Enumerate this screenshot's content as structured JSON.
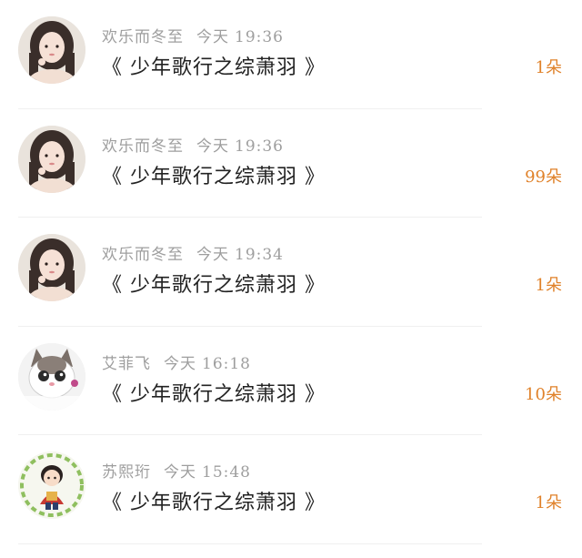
{
  "colors": {
    "count": "#e0822a",
    "meta": "#9e9e9e",
    "title": "#222222"
  },
  "items": [
    {
      "name": "欢乐而冬至",
      "time_prefix": "今天",
      "time": "19:36",
      "title": "《 少年歌行之综萧羽 》",
      "count": "1朵",
      "avatar": "girl-avatar"
    },
    {
      "name": "欢乐而冬至",
      "time_prefix": "今天",
      "time": "19:36",
      "title": "《 少年歌行之综萧羽 》",
      "count": "99朵",
      "avatar": "girl-avatar"
    },
    {
      "name": "欢乐而冬至",
      "time_prefix": "今天",
      "time": "19:34",
      "title": "《 少年歌行之综萧羽 》",
      "count": "1朵",
      "avatar": "girl-avatar"
    },
    {
      "name": "艾菲飞",
      "time_prefix": "今天",
      "time": "16:18",
      "title": "《 少年歌行之综萧羽 》",
      "count": "10朵",
      "avatar": "cat-avatar"
    },
    {
      "name": "苏熙珩",
      "time_prefix": "今天",
      "time": "15:48",
      "title": "《 少年歌行之综萧羽 》",
      "count": "1朵",
      "avatar": "boy-avatar"
    }
  ]
}
